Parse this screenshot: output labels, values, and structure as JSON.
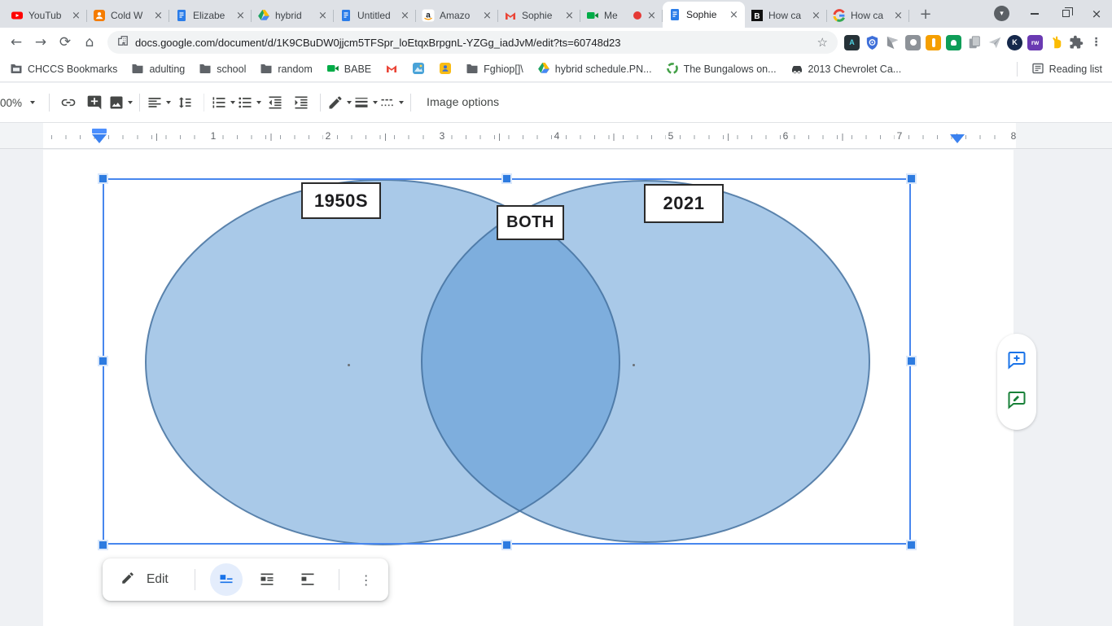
{
  "glyphs": {
    "close": "×",
    "plus": "+",
    "back": "←",
    "forward": "→",
    "reload": "⟳",
    "home": "⌂",
    "star": "☆",
    "kebab": "⋮",
    "chevron": "▾",
    "amazon_a": "a",
    "bing_b": "B",
    "google_g": "G",
    "kami_k": "K",
    "rw": "rw",
    "ext_a": "A"
  },
  "browser": {
    "tabs": [
      {
        "title": "YouTub",
        "icon": "youtube"
      },
      {
        "title": "Cold W",
        "icon": "contacts"
      },
      {
        "title": "Elizabe",
        "icon": "google-docs"
      },
      {
        "title": "hybrid",
        "icon": "google-drive"
      },
      {
        "title": "Untitled",
        "icon": "google-docs"
      },
      {
        "title": "Amazo",
        "icon": "amazon"
      },
      {
        "title": "Sophie",
        "icon": "gmail"
      },
      {
        "title": "Me",
        "icon": "google-meet",
        "recording": true
      },
      {
        "title": "Sophie",
        "icon": "google-docs",
        "active": true
      },
      {
        "title": "How ca",
        "icon": "bing"
      },
      {
        "title": "How ca",
        "icon": "google"
      }
    ],
    "nav": {
      "url": "docs.google.com/document/d/1K9CBuDW0jjcm5TFSpr_loEtqxBrpgnL-YZGg_iadJvM/edit?ts=60748d23"
    },
    "bookmarks": {
      "items": [
        {
          "label": "CHCCS Bookmarks",
          "icon": "managed-folder"
        },
        {
          "label": "adulting",
          "icon": "folder"
        },
        {
          "label": "school",
          "icon": "folder"
        },
        {
          "label": "random",
          "icon": "folder"
        },
        {
          "label": "BABE",
          "icon": "google-meet"
        },
        {
          "label": "",
          "icon": "gmail"
        },
        {
          "label": "",
          "icon": "app-blue"
        },
        {
          "label": "",
          "icon": "app-yellow"
        },
        {
          "label": "Fghiop[]\\",
          "icon": "folder"
        },
        {
          "label": "hybrid schedule.PN...",
          "icon": "google-drive"
        },
        {
          "label": "The Bungalows on...",
          "icon": "recycle-green"
        },
        {
          "label": "2013 Chevrolet Ca...",
          "icon": "car"
        }
      ],
      "reading_list": "Reading list"
    }
  },
  "docs": {
    "toolbar": {
      "zoom_value": "00%",
      "image_options": "Image options"
    },
    "ruler": {
      "numbers": [
        "1",
        "2",
        "3",
        "4",
        "5",
        "6",
        "7",
        "8"
      ]
    },
    "diagram": {
      "left_label": "1950S",
      "center_label": "BOTH",
      "right_label": "2021"
    },
    "edit_toolbar": {
      "edit": "Edit"
    }
  },
  "colors": {
    "accent": "#1a73e8",
    "selection": "#4285f4",
    "venn_fill": "#a9c9e8",
    "venn_overlap": "#7fadda",
    "venn_border": "#44719f"
  }
}
